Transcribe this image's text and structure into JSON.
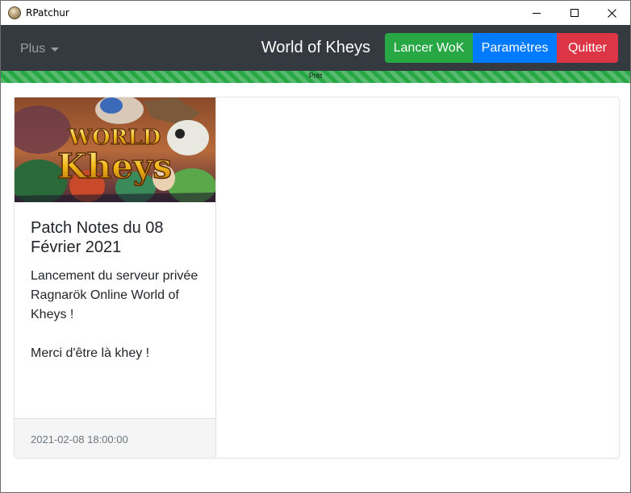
{
  "window": {
    "title": "RPatchur"
  },
  "navbar": {
    "menu_label": "Plus",
    "brand": "World of Kheys",
    "buttons": {
      "launch": "Lancer WoK",
      "settings": "Paramètres",
      "quit": "Quitter"
    }
  },
  "progress": {
    "label": "Prêt",
    "value": 100,
    "color": "#28a745"
  },
  "news": [
    {
      "image_text": [
        "WORLD",
        "Kheys"
      ],
      "title": "Patch Notes du 08 Février 2021",
      "paragraphs": [
        "Lancement du serveur privée Ragnarök Online World of Kheys !",
        "Merci d'être là khey !"
      ],
      "date": "2021-02-08 18:00:00"
    }
  ],
  "colors": {
    "navbar": "#343a40",
    "launch": "#28a745",
    "settings": "#007bff",
    "quit": "#dc3545"
  }
}
